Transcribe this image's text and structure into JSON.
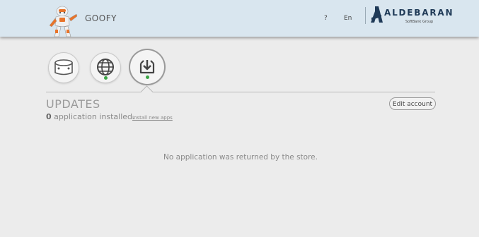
{
  "header": {
    "robot_name": "GOOFY",
    "help_label": "?",
    "language_label": "En",
    "brand": {
      "name": "ALDEBARAN",
      "subtitle": "SoftBank Group",
      "color": "#1f3a57"
    }
  },
  "nav": {
    "items": [
      {
        "name": "robot",
        "icon": "robot-head-icon"
      },
      {
        "name": "app-store",
        "icon": "globe-icon",
        "status": "online"
      },
      {
        "name": "updates",
        "icon": "download-icon",
        "status": "online",
        "active": true
      }
    ],
    "status_color": "#3aa544"
  },
  "updates": {
    "title": "UPDATES",
    "installed_count": "0",
    "installed_text": " application installed.",
    "install_link": "Install new apps",
    "edit_account_label": "Edit account",
    "empty_message": "No application was returned by the store."
  }
}
